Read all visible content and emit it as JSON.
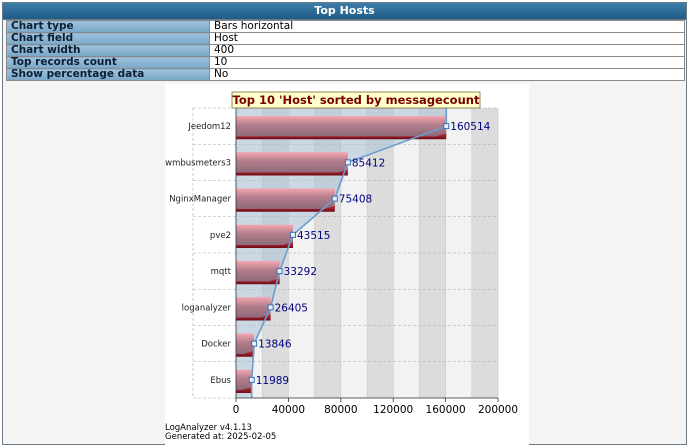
{
  "header": {
    "title": "Top Hosts"
  },
  "properties": [
    {
      "key": "Chart type",
      "value": "Bars horizontal"
    },
    {
      "key": "Chart field",
      "value": "Host"
    },
    {
      "key": "Chart width",
      "value": "400"
    },
    {
      "key": "Top records count",
      "value": "10"
    },
    {
      "key": "Show percentage data",
      "value": "No"
    }
  ],
  "chart_data": {
    "type": "bar",
    "orientation": "horizontal",
    "title": "Top 10 'Host' sorted by messagecount",
    "categories": [
      "Jeedom12",
      "wmbusmeters3",
      "NginxManager",
      "pve2",
      "mqtt",
      "loganalyzer",
      "Docker",
      "Ebus"
    ],
    "values": [
      160514,
      85412,
      75408,
      43515,
      33292,
      26405,
      13846,
      11989
    ],
    "xlim": [
      0,
      200000
    ],
    "xticks": [
      "0",
      "40000",
      "80000",
      "120000",
      "160000",
      "200000"
    ],
    "xlabel": "",
    "ylabel": "",
    "grid": true,
    "value_labels": true,
    "colors": {
      "bar_top": "#f3a7b0",
      "bar_mid": "#b27d8a",
      "bar_bottom": "#8e6a7b",
      "bar_end": "#6a0b14",
      "line": "#6e9ccc",
      "area": "#a9c2d9",
      "title_bg": "#ffffcc",
      "title_text": "#7a0000",
      "label_text": "#000080"
    }
  },
  "footer": {
    "version": "LogAnalyzer v4.1.13",
    "generated": "Generated at: 2025-02-05"
  }
}
